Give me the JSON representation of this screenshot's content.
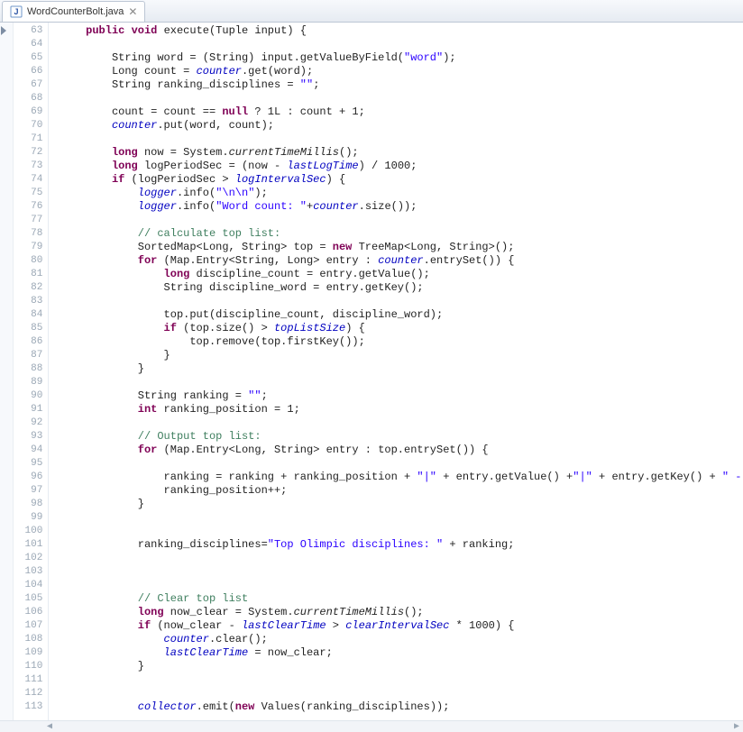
{
  "tab": {
    "title": "WordCounterBolt.java",
    "icon": "java-file-icon",
    "close_tooltip": "Close"
  },
  "editor": {
    "first_line": 63,
    "lines": [
      "    public void execute(Tuple input) {",
      "",
      "        String word = (String) input.getValueByField(\"word\");",
      "        Long count = counter.get(word);",
      "        String ranking_disciplines = \"\";",
      "",
      "        count = count == null ? 1L : count + 1;",
      "        counter.put(word, count);",
      "",
      "        long now = System.currentTimeMillis();",
      "        long logPeriodSec = (now - lastLogTime) / 1000;",
      "        if (logPeriodSec > logIntervalSec) {",
      "            logger.info(\"\\n\\n\");",
      "            logger.info(\"Word count: \"+counter.size());",
      "",
      "            // calculate top list:",
      "            SortedMap<Long, String> top = new TreeMap<Long, String>();",
      "            for (Map.Entry<String, Long> entry : counter.entrySet()) {",
      "                long discipline_count = entry.getValue();",
      "                String discipline_word = entry.getKey();",
      "",
      "                top.put(discipline_count, discipline_word);",
      "                if (top.size() > topListSize) {",
      "                    top.remove(top.firstKey());",
      "                }",
      "            }",
      "",
      "            String ranking = \"\";",
      "            int ranking_position = 1;",
      "",
      "            // Output top list:",
      "            for (Map.Entry<Long, String> entry : top.entrySet()) {",
      "",
      "                ranking = ranking + ranking_position + \"|\" + entry.getValue() +\"|\" + entry.getKey() + \" - \" ;",
      "                ranking_position++;",
      "            }",
      "",
      "",
      "            ranking_disciplines=\"Top Olimpic disciplines: \" + ranking;",
      "",
      "",
      "",
      "            // Clear top list",
      "            long now_clear = System.currentTimeMillis();",
      "            if (now_clear - lastClearTime > clearIntervalSec * 1000) {",
      "                counter.clear();",
      "                lastClearTime = now_clear;",
      "            }",
      "",
      "",
      "            collector.emit(new Values(ranking_disciplines));"
    ]
  },
  "syntax": {
    "keywords": [
      "public",
      "void",
      "long",
      "int",
      "if",
      "for",
      "new",
      "null"
    ],
    "fields": [
      "counter",
      "lastLogTime",
      "logIntervalSec",
      "logger",
      "topListSize",
      "lastClearTime",
      "clearIntervalSec",
      "collector"
    ],
    "italic_methods": [
      "currentTimeMillis"
    ]
  }
}
